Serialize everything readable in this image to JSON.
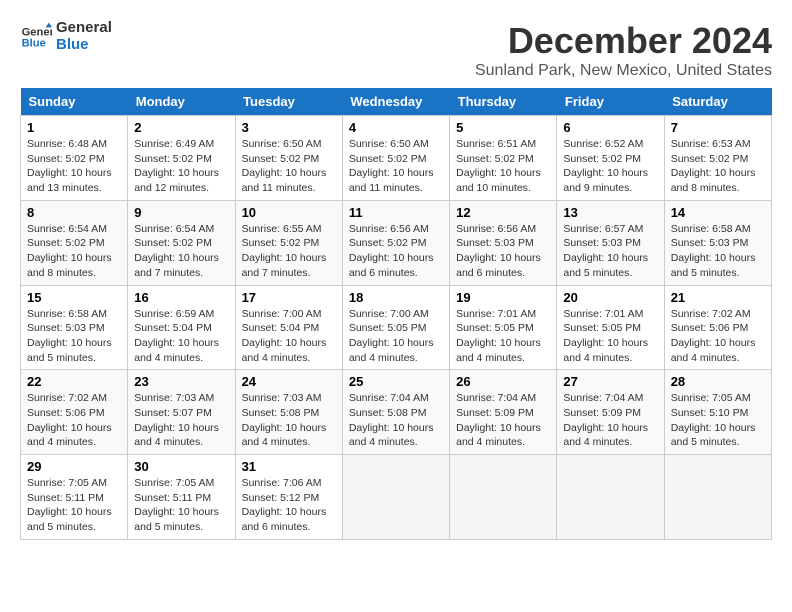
{
  "logo": {
    "line1": "General",
    "line2": "Blue"
  },
  "title": "December 2024",
  "subtitle": "Sunland Park, New Mexico, United States",
  "weekdays": [
    "Sunday",
    "Monday",
    "Tuesday",
    "Wednesday",
    "Thursday",
    "Friday",
    "Saturday"
  ],
  "weeks": [
    [
      {
        "day": "1",
        "info": "Sunrise: 6:48 AM\nSunset: 5:02 PM\nDaylight: 10 hours\nand 13 minutes."
      },
      {
        "day": "2",
        "info": "Sunrise: 6:49 AM\nSunset: 5:02 PM\nDaylight: 10 hours\nand 12 minutes."
      },
      {
        "day": "3",
        "info": "Sunrise: 6:50 AM\nSunset: 5:02 PM\nDaylight: 10 hours\nand 11 minutes."
      },
      {
        "day": "4",
        "info": "Sunrise: 6:50 AM\nSunset: 5:02 PM\nDaylight: 10 hours\nand 11 minutes."
      },
      {
        "day": "5",
        "info": "Sunrise: 6:51 AM\nSunset: 5:02 PM\nDaylight: 10 hours\nand 10 minutes."
      },
      {
        "day": "6",
        "info": "Sunrise: 6:52 AM\nSunset: 5:02 PM\nDaylight: 10 hours\nand 9 minutes."
      },
      {
        "day": "7",
        "info": "Sunrise: 6:53 AM\nSunset: 5:02 PM\nDaylight: 10 hours\nand 8 minutes."
      }
    ],
    [
      {
        "day": "8",
        "info": "Sunrise: 6:54 AM\nSunset: 5:02 PM\nDaylight: 10 hours\nand 8 minutes."
      },
      {
        "day": "9",
        "info": "Sunrise: 6:54 AM\nSunset: 5:02 PM\nDaylight: 10 hours\nand 7 minutes."
      },
      {
        "day": "10",
        "info": "Sunrise: 6:55 AM\nSunset: 5:02 PM\nDaylight: 10 hours\nand 7 minutes."
      },
      {
        "day": "11",
        "info": "Sunrise: 6:56 AM\nSunset: 5:02 PM\nDaylight: 10 hours\nand 6 minutes."
      },
      {
        "day": "12",
        "info": "Sunrise: 6:56 AM\nSunset: 5:03 PM\nDaylight: 10 hours\nand 6 minutes."
      },
      {
        "day": "13",
        "info": "Sunrise: 6:57 AM\nSunset: 5:03 PM\nDaylight: 10 hours\nand 5 minutes."
      },
      {
        "day": "14",
        "info": "Sunrise: 6:58 AM\nSunset: 5:03 PM\nDaylight: 10 hours\nand 5 minutes."
      }
    ],
    [
      {
        "day": "15",
        "info": "Sunrise: 6:58 AM\nSunset: 5:03 PM\nDaylight: 10 hours\nand 5 minutes."
      },
      {
        "day": "16",
        "info": "Sunrise: 6:59 AM\nSunset: 5:04 PM\nDaylight: 10 hours\nand 4 minutes."
      },
      {
        "day": "17",
        "info": "Sunrise: 7:00 AM\nSunset: 5:04 PM\nDaylight: 10 hours\nand 4 minutes."
      },
      {
        "day": "18",
        "info": "Sunrise: 7:00 AM\nSunset: 5:05 PM\nDaylight: 10 hours\nand 4 minutes."
      },
      {
        "day": "19",
        "info": "Sunrise: 7:01 AM\nSunset: 5:05 PM\nDaylight: 10 hours\nand 4 minutes."
      },
      {
        "day": "20",
        "info": "Sunrise: 7:01 AM\nSunset: 5:05 PM\nDaylight: 10 hours\nand 4 minutes."
      },
      {
        "day": "21",
        "info": "Sunrise: 7:02 AM\nSunset: 5:06 PM\nDaylight: 10 hours\nand 4 minutes."
      }
    ],
    [
      {
        "day": "22",
        "info": "Sunrise: 7:02 AM\nSunset: 5:06 PM\nDaylight: 10 hours\nand 4 minutes."
      },
      {
        "day": "23",
        "info": "Sunrise: 7:03 AM\nSunset: 5:07 PM\nDaylight: 10 hours\nand 4 minutes."
      },
      {
        "day": "24",
        "info": "Sunrise: 7:03 AM\nSunset: 5:08 PM\nDaylight: 10 hours\nand 4 minutes."
      },
      {
        "day": "25",
        "info": "Sunrise: 7:04 AM\nSunset: 5:08 PM\nDaylight: 10 hours\nand 4 minutes."
      },
      {
        "day": "26",
        "info": "Sunrise: 7:04 AM\nSunset: 5:09 PM\nDaylight: 10 hours\nand 4 minutes."
      },
      {
        "day": "27",
        "info": "Sunrise: 7:04 AM\nSunset: 5:09 PM\nDaylight: 10 hours\nand 4 minutes."
      },
      {
        "day": "28",
        "info": "Sunrise: 7:05 AM\nSunset: 5:10 PM\nDaylight: 10 hours\nand 5 minutes."
      }
    ],
    [
      {
        "day": "29",
        "info": "Sunrise: 7:05 AM\nSunset: 5:11 PM\nDaylight: 10 hours\nand 5 minutes."
      },
      {
        "day": "30",
        "info": "Sunrise: 7:05 AM\nSunset: 5:11 PM\nDaylight: 10 hours\nand 5 minutes."
      },
      {
        "day": "31",
        "info": "Sunrise: 7:06 AM\nSunset: 5:12 PM\nDaylight: 10 hours\nand 6 minutes."
      },
      {
        "day": "",
        "info": ""
      },
      {
        "day": "",
        "info": ""
      },
      {
        "day": "",
        "info": ""
      },
      {
        "day": "",
        "info": ""
      }
    ]
  ]
}
